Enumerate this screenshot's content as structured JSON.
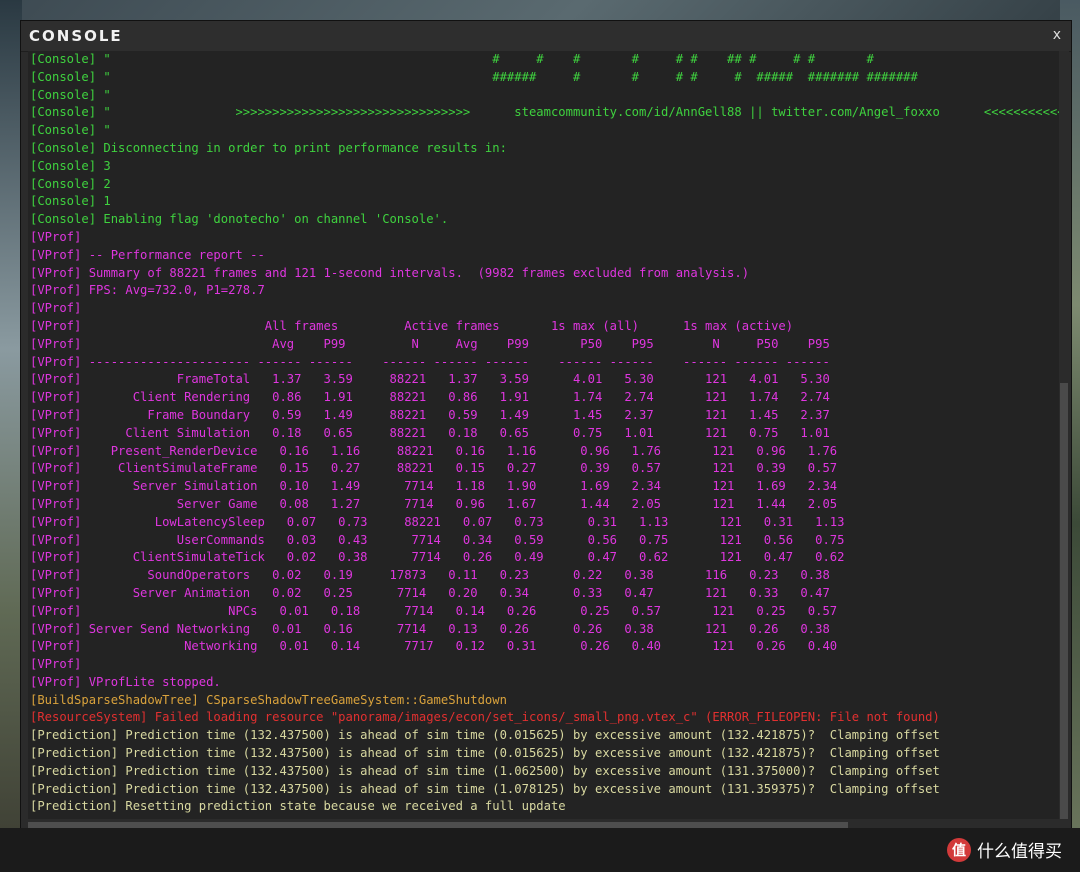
{
  "window": {
    "title": "CONSOLE",
    "close_label": "x"
  },
  "watermark": {
    "text": "什么值得买",
    "logo_glyph": "值"
  },
  "colors": {
    "console": "#3fd23f",
    "vprof": "#df36df",
    "build": "#d9a23c",
    "resource": "#e23030",
    "prediction": "#d8d8a0"
  },
  "lines": [
    {
      "color": "#3fd23f",
      "text": "[Console] \"                                                    #     #    #       #     # #    ## #     # #       #"
    },
    {
      "color": "#3fd23f",
      "text": "[Console] \"                                                    ######     #       #     # #     #  #####  ####### #######"
    },
    {
      "color": "#3fd23f",
      "text": "[Console] \""
    },
    {
      "color": "#3fd23f",
      "text": "[Console] \"                 >>>>>>>>>>>>>>>>>>>>>>>>>>>>>>>>      steamcommunity.com/id/AnnGell88 || twitter.com/Angel_foxxo      <<<<<<<<<<<<<<<<"
    },
    {
      "color": "#3fd23f",
      "text": "[Console] \""
    },
    {
      "color": "#3fd23f",
      "text": "[Console] Disconnecting in order to print performance results in:"
    },
    {
      "color": "#3fd23f",
      "text": "[Console] 3"
    },
    {
      "color": "#3fd23f",
      "text": "[Console] 2"
    },
    {
      "color": "#3fd23f",
      "text": "[Console] 1"
    },
    {
      "color": "#3fd23f",
      "text": "[Console] Enabling flag 'donotecho' on channel 'Console'."
    },
    {
      "color": "#df36df",
      "text": "[VProf]"
    },
    {
      "color": "#df36df",
      "text": "[VProf] -- Performance report --"
    },
    {
      "color": "#df36df",
      "text": "[VProf] Summary of 88221 frames and 121 1-second intervals.  (9982 frames excluded from analysis.)"
    },
    {
      "color": "#df36df",
      "text": "[VProf] FPS: Avg=732.0, P1=278.7"
    },
    {
      "color": "#df36df",
      "text": "[VProf]"
    },
    {
      "color": "#df36df",
      "text": "[VProf]                         All frames         Active frames       1s max (all)      1s max (active)"
    },
    {
      "color": "#df36df",
      "text": "[VProf]                          Avg    P99         N     Avg    P99       P50    P95        N     P50    P95"
    },
    {
      "color": "#df36df",
      "text": "[VProf] ---------------------- ------ ------    ------ ------ ------    ------ ------    ------ ------ ------"
    },
    {
      "color": "#df36df",
      "text": "[VProf]             FrameTotal   1.37   3.59     88221   1.37   3.59      4.01   5.30       121   4.01   5.30"
    },
    {
      "color": "#df36df",
      "text": "[VProf]       Client Rendering   0.86   1.91     88221   0.86   1.91      1.74   2.74       121   1.74   2.74"
    },
    {
      "color": "#df36df",
      "text": "[VProf]         Frame Boundary   0.59   1.49     88221   0.59   1.49      1.45   2.37       121   1.45   2.37"
    },
    {
      "color": "#df36df",
      "text": "[VProf]      Client Simulation   0.18   0.65     88221   0.18   0.65      0.75   1.01       121   0.75   1.01"
    },
    {
      "color": "#df36df",
      "text": "[VProf]    Present_RenderDevice   0.16   1.16     88221   0.16   1.16      0.96   1.76       121   0.96   1.76"
    },
    {
      "color": "#df36df",
      "text": "[VProf]     ClientSimulateFrame   0.15   0.27     88221   0.15   0.27      0.39   0.57       121   0.39   0.57"
    },
    {
      "color": "#df36df",
      "text": "[VProf]       Server Simulation   0.10   1.49      7714   1.18   1.90      1.69   2.34       121   1.69   2.34"
    },
    {
      "color": "#df36df",
      "text": "[VProf]             Server Game   0.08   1.27      7714   0.96   1.67      1.44   2.05       121   1.44   2.05"
    },
    {
      "color": "#df36df",
      "text": "[VProf]          LowLatencySleep   0.07   0.73     88221   0.07   0.73      0.31   1.13       121   0.31   1.13"
    },
    {
      "color": "#df36df",
      "text": "[VProf]             UserCommands   0.03   0.43      7714   0.34   0.59      0.56   0.75       121   0.56   0.75"
    },
    {
      "color": "#df36df",
      "text": "[VProf]       ClientSimulateTick   0.02   0.38      7714   0.26   0.49      0.47   0.62       121   0.47   0.62"
    },
    {
      "color": "#df36df",
      "text": "[VProf]         SoundOperators   0.02   0.19     17873   0.11   0.23      0.22   0.38       116   0.23   0.38"
    },
    {
      "color": "#df36df",
      "text": "[VProf]       Server Animation   0.02   0.25      7714   0.20   0.34      0.33   0.47       121   0.33   0.47"
    },
    {
      "color": "#df36df",
      "text": "[VProf]                    NPCs   0.01   0.18      7714   0.14   0.26      0.25   0.57       121   0.25   0.57"
    },
    {
      "color": "#df36df",
      "text": "[VProf] Server Send Networking   0.01   0.16      7714   0.13   0.26      0.26   0.38       121   0.26   0.38"
    },
    {
      "color": "#df36df",
      "text": "[VProf]              Networking   0.01   0.14      7717   0.12   0.31      0.26   0.40       121   0.26   0.40"
    },
    {
      "color": "#df36df",
      "text": "[VProf]"
    },
    {
      "color": "#df36df",
      "text": "[VProf] VProfLite stopped."
    },
    {
      "color": "#d9a23c",
      "text": "[BuildSparseShadowTree] CSparseShadowTreeGameSystem::GameShutdown"
    },
    {
      "color": "#e23030",
      "text": "[ResourceSystem] Failed loading resource \"panorama/images/econ/set_icons/_small_png.vtex_c\" (ERROR_FILEOPEN: File not found)"
    },
    {
      "color": "#d8d8a0",
      "text": "[Prediction] Prediction time (132.437500) is ahead of sim time (0.015625) by excessive amount (132.421875)?  Clamping offset"
    },
    {
      "color": "#d8d8a0",
      "text": "[Prediction] Prediction time (132.437500) is ahead of sim time (0.015625) by excessive amount (132.421875)?  Clamping offset"
    },
    {
      "color": "#d8d8a0",
      "text": "[Prediction] Prediction time (132.437500) is ahead of sim time (1.062500) by excessive amount (131.375000)?  Clamping offset"
    },
    {
      "color": "#d8d8a0",
      "text": "[Prediction] Prediction time (132.437500) is ahead of sim time (1.078125) by excessive amount (131.359375)?  Clamping offset"
    },
    {
      "color": "#d8d8a0",
      "text": "[Prediction] Resetting prediction state because we received a full update"
    }
  ],
  "input": {
    "value": "",
    "placeholder": ""
  }
}
